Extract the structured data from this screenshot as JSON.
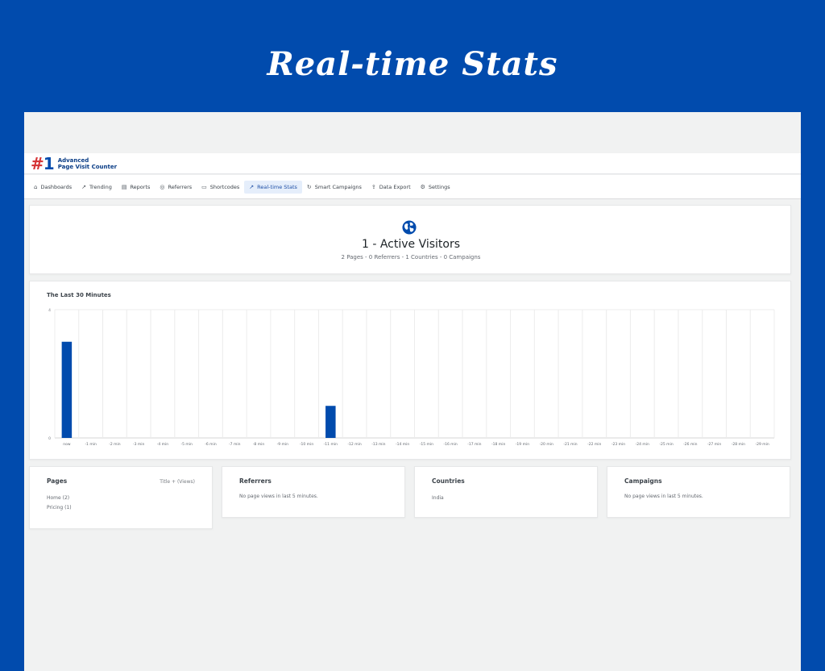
{
  "hero": {
    "title": "Real-time Stats"
  },
  "brand": {
    "mark_hash": "#",
    "mark_one": "1",
    "line1": "Advanced",
    "line2": "Page Visit Counter"
  },
  "nav": [
    {
      "label": "Dashboards",
      "icon": "home-icon",
      "glyph": "⌂",
      "active": false
    },
    {
      "label": "Trending",
      "icon": "trending-icon",
      "glyph": "↗",
      "active": false
    },
    {
      "label": "Reports",
      "icon": "document-icon",
      "glyph": "▤",
      "active": false
    },
    {
      "label": "Referrers",
      "icon": "globe-icon",
      "glyph": "◎",
      "active": false
    },
    {
      "label": "Shortcodes",
      "icon": "shortcode-icon",
      "glyph": "▭",
      "active": false
    },
    {
      "label": "Real-time Stats",
      "icon": "chart-icon",
      "glyph": "↗",
      "active": true
    },
    {
      "label": "Smart Campaigns",
      "icon": "refresh-icon",
      "glyph": "↻",
      "active": false
    },
    {
      "label": "Data Export",
      "icon": "export-icon",
      "glyph": "⇪",
      "active": false
    },
    {
      "label": "Settings",
      "icon": "gear-icon",
      "glyph": "⚙",
      "active": false
    }
  ],
  "summary": {
    "icon": "globe-icon",
    "title": "1 - Active Visitors",
    "subtitle": "2 Pages - 0 Referrers - 1 Countries - 0 Campaigns"
  },
  "chart_title": "The Last 30 Minutes",
  "chart_data": {
    "type": "bar",
    "categories": [
      "now",
      "-1 min",
      "-2 min",
      "-3 min",
      "-4 min",
      "-5 min",
      "-6 min",
      "-7 min",
      "-8 min",
      "-9 min",
      "-10 min",
      "-11 min",
      "-12 min",
      "-13 min",
      "-14 min",
      "-15 min",
      "-16 min",
      "-17 min",
      "-18 min",
      "-19 min",
      "-20 min",
      "-21 min",
      "-22 min",
      "-23 min",
      "-24 min",
      "-25 min",
      "-26 min",
      "-27 min",
      "-28 min",
      "-29 min"
    ],
    "values": [
      3,
      0,
      0,
      0,
      0,
      0,
      0,
      0,
      0,
      0,
      0,
      1,
      0,
      0,
      0,
      0,
      0,
      0,
      0,
      0,
      0,
      0,
      0,
      0,
      0,
      0,
      0,
      0,
      0,
      0
    ],
    "ylim": [
      0,
      4
    ],
    "yticks": [
      "0",
      "4"
    ],
    "color": "#014bad",
    "grid": true
  },
  "panels": {
    "pages": {
      "title": "Pages",
      "hint": "Title + (Views)",
      "items": [
        "Home (2)",
        "Pricing (1)"
      ]
    },
    "referrers": {
      "title": "Referrers",
      "message": "No page views in last 5 minutes."
    },
    "countries": {
      "title": "Countries",
      "items": [
        "India"
      ]
    },
    "campaigns": {
      "title": "Campaigns",
      "message": "No page views in last 5 minutes."
    }
  },
  "colors": {
    "background": "#014bad",
    "accent": "#014bad",
    "logo_hash": "#d63638"
  }
}
